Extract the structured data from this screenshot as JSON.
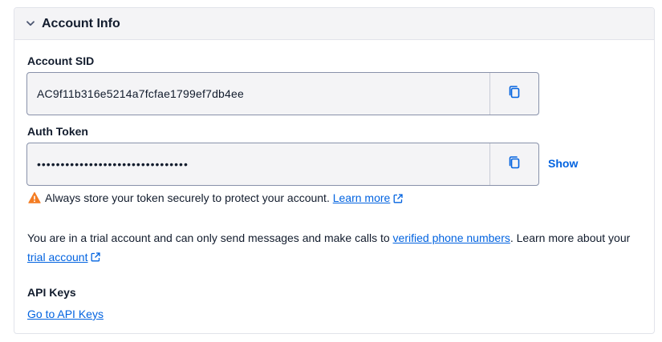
{
  "panel": {
    "title": "Account Info",
    "chevron_icon": "chevron-down-icon"
  },
  "account_sid": {
    "label": "Account SID",
    "value": "AC9f11b316e5214a7fcfae1799ef7db4ee",
    "copy_icon": "copy-icon"
  },
  "auth_token": {
    "label": "Auth Token",
    "value": "••••••••••••••••••••••••••••••••",
    "copy_icon": "copy-icon",
    "show_label": "Show"
  },
  "warning": {
    "icon": "warning-triangle-icon",
    "text": "Always store your token securely to protect your account.",
    "link_label": "Learn more"
  },
  "trial": {
    "text_before": "You are in a trial account and can only send messages and make calls to",
    "verified_link": "verified phone numbers",
    "text_middle": ". Learn more about your",
    "trial_link": "trial account"
  },
  "api_keys": {
    "heading": "API Keys",
    "link_label": "Go to API Keys"
  },
  "colors": {
    "link": "#0263e0",
    "text": "#121c2d",
    "warning": "#f47c22",
    "field_bg": "#f4f4f6",
    "field_border": "#8891aa"
  }
}
